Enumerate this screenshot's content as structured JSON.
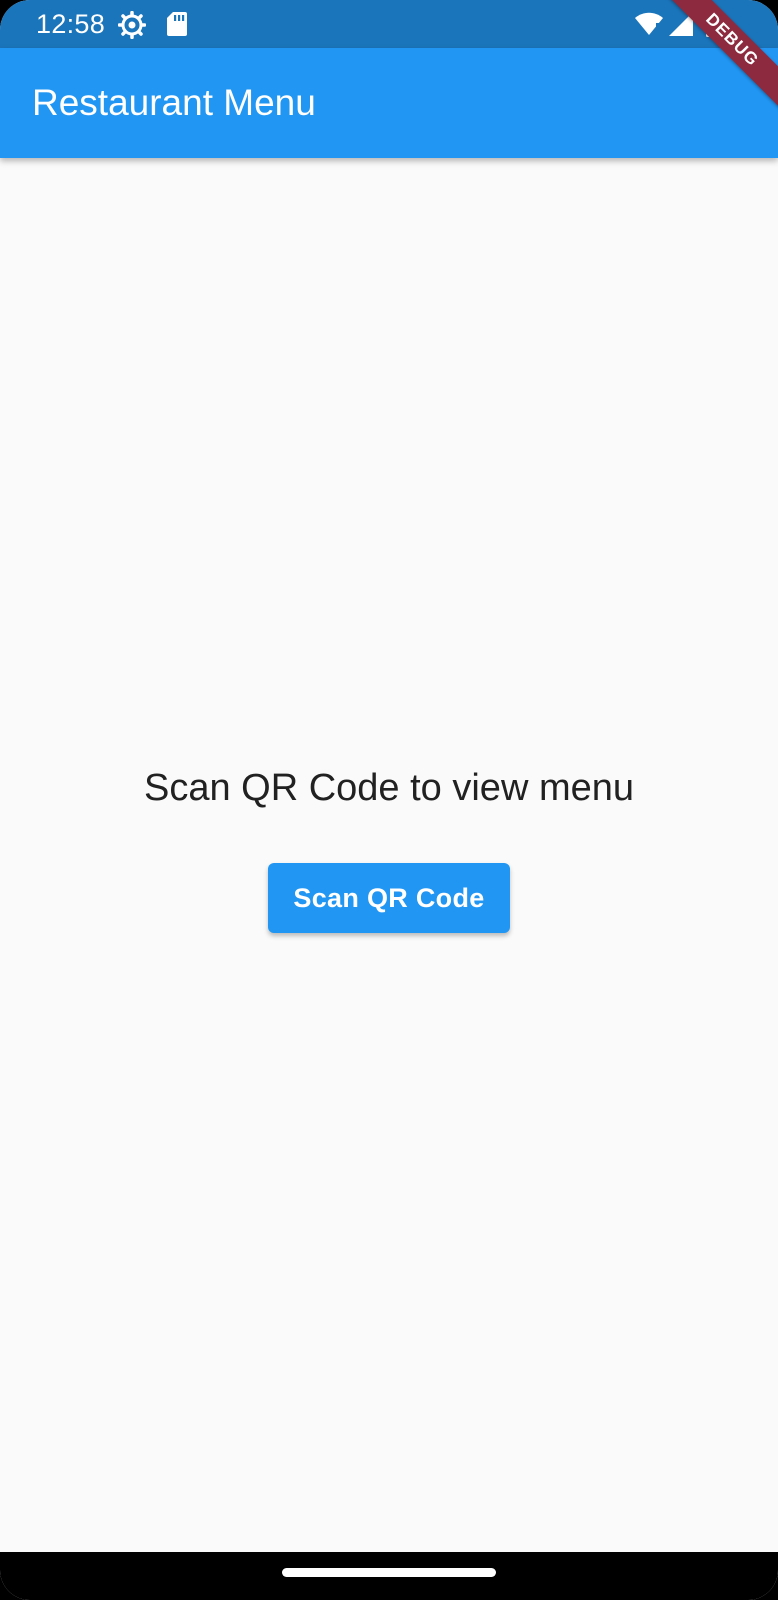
{
  "status_bar": {
    "time": "12:58",
    "icons": [
      "settings-gear-icon",
      "sd-card-icon",
      "wifi-icon",
      "signal-icon",
      "battery-icon"
    ]
  },
  "app_bar": {
    "title": "Restaurant Menu",
    "color": "#2196f3"
  },
  "debug_banner": {
    "label": "DEBUG"
  },
  "main": {
    "message": "Scan QR Code to view menu",
    "scan_button_label": "Scan QR Code"
  },
  "colors": {
    "status_bar": "#1b75bb",
    "primary": "#2196f3",
    "background": "#fafafa",
    "debug_banner": "#8d2a3f"
  }
}
